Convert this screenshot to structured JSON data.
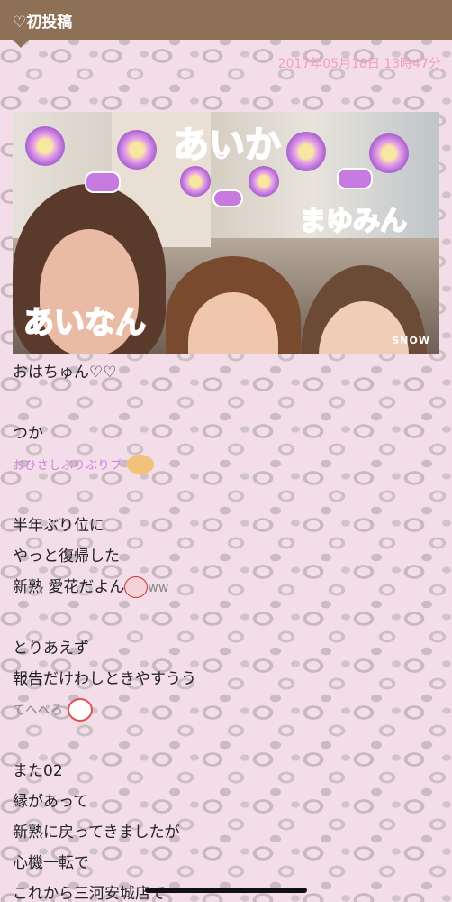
{
  "header": {
    "title": "♡初投稿"
  },
  "post": {
    "date": "2017年05月18日 13時47分",
    "photo": {
      "stickers": [
        "あいか",
        "まゆみん",
        "あいなん",
        "SNOW"
      ]
    },
    "lines": [
      "おはちゅん♡♡",
      "",
      "つか",
      "おひさしぶりぶりブ",
      "",
      "半年ぶり位に",
      "やっと復帰した",
      "新熟 愛花だよん",
      "",
      "とりあえず",
      "報告だけわしときやすうう",
      "てへぺろ",
      "",
      "また02",
      "縁があって",
      "新熟に戻ってきましたが",
      "心機一転で",
      "これから三河安城店で"
    ],
    "ww_text": "ww"
  },
  "colors": {
    "header": "#8d7055",
    "date": "#f2a0bd",
    "background": "#f3dde8"
  }
}
